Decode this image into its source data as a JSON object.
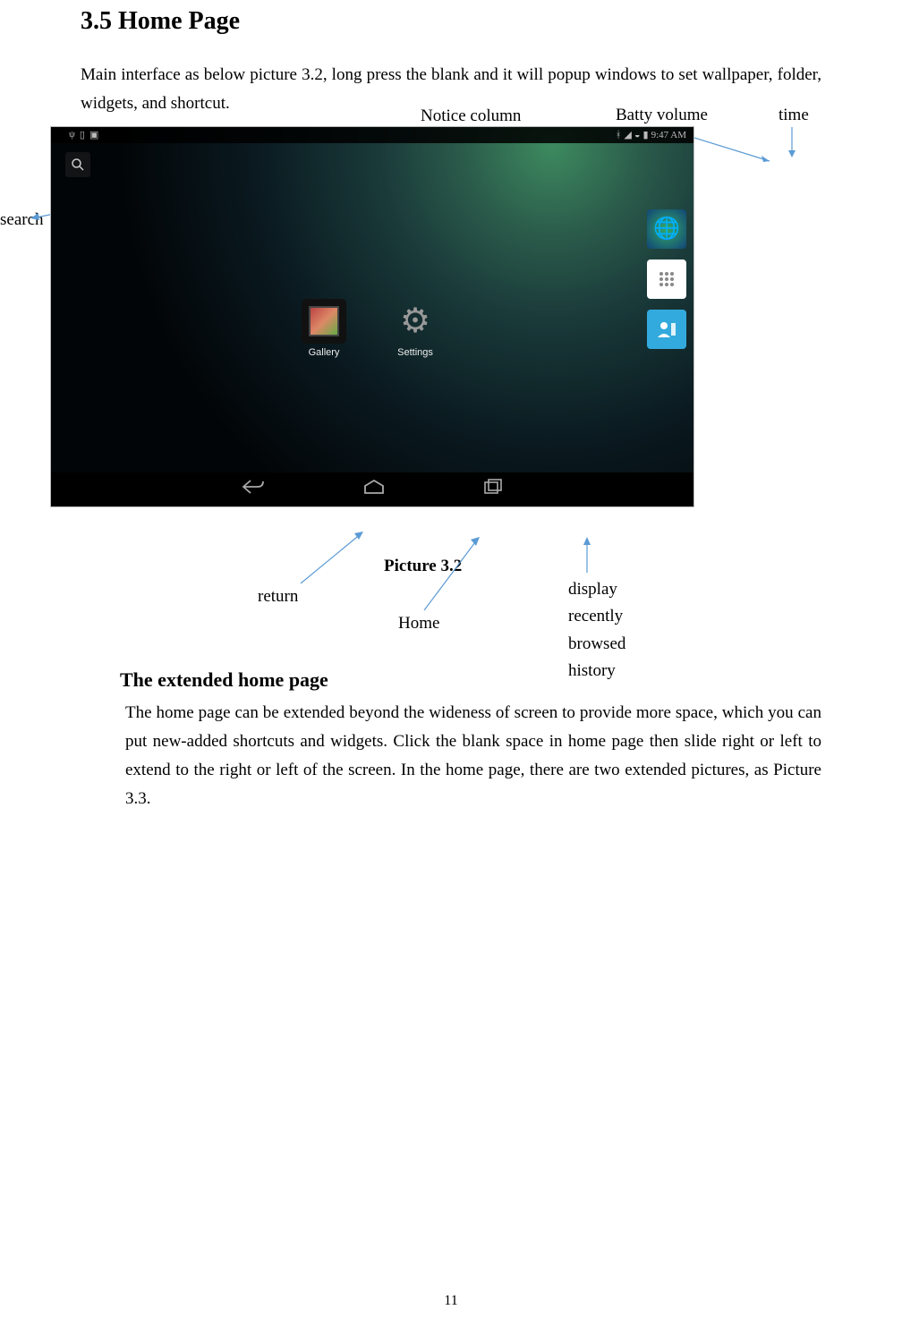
{
  "section_title": "3.5 Home Page",
  "intro_text": "Main interface as below picture 3.2, long press the blank and it will popup windows to set wallpaper, folder, widgets, and shortcut.",
  "callouts": {
    "notice": "Notice column",
    "battery": "Batty volume",
    "time": "time",
    "search": "search",
    "return": "return",
    "home": "Home",
    "recent": "display recently browsed history"
  },
  "caption": "Picture 3.2",
  "screenshot": {
    "status_time": "9:47 AM",
    "apps": {
      "gallery": "Gallery",
      "settings": "Settings"
    },
    "icons": {
      "search": "search-icon",
      "back": "back-icon",
      "home": "home-icon",
      "recent": "recent-icon",
      "bluetooth": "bluetooth-icon",
      "wifi": "wifi-icon",
      "battery": "battery-icon",
      "browser": "browser-icon",
      "appdrawer": "appdrawer-icon",
      "contacts": "contacts-icon"
    }
  },
  "subheading": "The extended home page",
  "body2": "The home page can be extended beyond the wideness of screen to provide more space, which you can put new-added shortcuts and widgets. Click the blank space in home page then slide right or left to extend to the right or left of the screen. In the home page, there are two extended pictures, as Picture 3.3.",
  "page_number": "11"
}
